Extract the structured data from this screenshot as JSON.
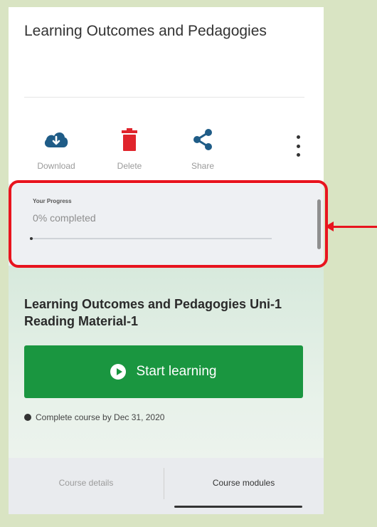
{
  "course_title": "Learning Outcomes and Pedagogies",
  "actions": {
    "download_label": "Download",
    "delete_label": "Delete",
    "share_label": "Share",
    "download_icon": "cloud-download-icon",
    "delete_icon": "trash-icon",
    "share_icon": "share-icon",
    "more_icon": "more-vertical-icon"
  },
  "progress": {
    "label": "Your Progress",
    "text": "0% completed",
    "value_percent": 0
  },
  "module": {
    "title": "Learning Outcomes and Pedagogies Uni-1 Reading Material-1",
    "start_label": "Start learning",
    "deadline": "Complete course by Dec 31, 2020"
  },
  "tabs": {
    "details": "Course details",
    "modules": "Course modules",
    "active": "Course modules"
  },
  "colors": {
    "download": "#1f5c87",
    "delete": "#e0242c",
    "share": "#1f5c87",
    "start_button": "#1a9640",
    "highlight": "#e8141e",
    "background": "#d9e4c3"
  }
}
